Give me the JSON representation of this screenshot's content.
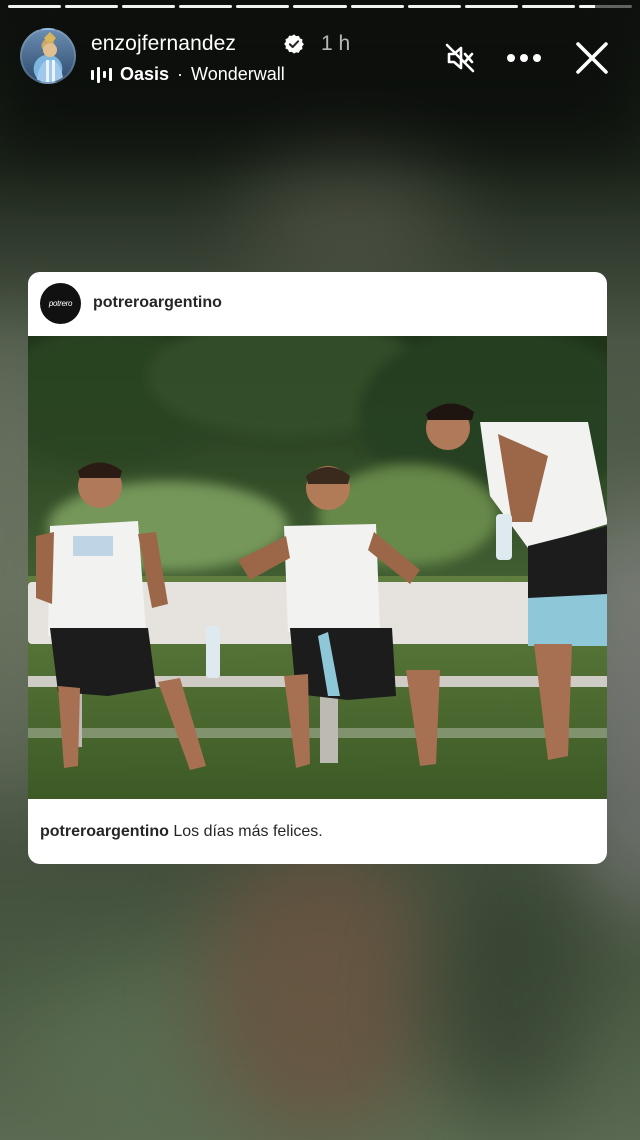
{
  "story": {
    "progress": {
      "segments_total": 11,
      "segments_complete": 10,
      "current_fraction": 0.3
    },
    "author": {
      "username": "enzojfernandez",
      "verified": true,
      "time_ago": "1 h"
    },
    "music": {
      "artist": "Oasis",
      "separator": "·",
      "song": "Wonderwall"
    },
    "controls": {
      "mute_icon": "speaker-muted-icon",
      "more_icon": "more-horizontal-icon",
      "close_icon": "close-icon"
    }
  },
  "shared_post": {
    "username": "potreroargentino",
    "avatar_text": "potrero",
    "caption_user": "potreroargentino",
    "caption_text": "Los días más felices."
  },
  "colors": {
    "card_bg": "#ffffff",
    "text_dark": "#262626",
    "text_white": "#ffffff"
  }
}
